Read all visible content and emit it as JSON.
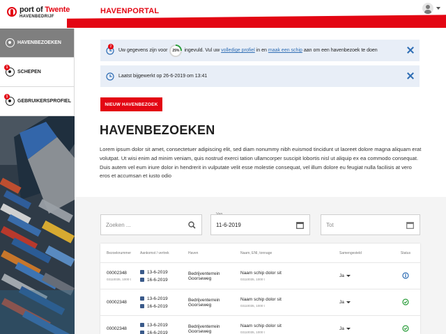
{
  "header": {
    "logo_name_part1": "port of ",
    "logo_name_part2": "Twente",
    "logo_sub": "HAVENBEDRIJF",
    "app_title": "HAVENPORTAL",
    "user_icon": "user-avatar-icon"
  },
  "sidebar": {
    "items": [
      {
        "label": "HAVENBEZOEKEN",
        "icon": "anchor-icon",
        "badge": ""
      },
      {
        "label": "SCHEPEN",
        "icon": "ship-icon",
        "badge": "1"
      },
      {
        "label": "GEBRUIKERSPROFIEL",
        "icon": "user-icon",
        "badge": "1"
      }
    ]
  },
  "alerts": [
    {
      "badge": "2",
      "text_before": "Uw gegevens zijn voor",
      "progress_label": "25%",
      "progress": 0.25,
      "text_mid": "ingevuld. Vul uw",
      "link1": "volledige profiel",
      "text_mid2": "in en",
      "link2": "maak een schip",
      "text_after": "aan om een havenbezoek te doen"
    },
    {
      "text": "Laatst bijgewerkt op 26-6-2019 om 13:41"
    }
  ],
  "main": {
    "new_button": "NIEUW HAVENBEZOEK",
    "title": "HAVENBEZOEKEN",
    "intro": "Lorem ipsum dolor sit amet, consectetuer adipiscing elit, sed diam nonummy nibh euismod tincidunt ut laoreet dolore magna aliquam erat volutpat. Ut wisi enim ad minim veniam, quis nostrud exerci tation ullamcorper suscipit lobortis nisl ut aliquip ex ea commodo consequat. Duis autem vel eum iriure dolor in hendrerit in vulputate velit esse molestie consequat, vel illum dolore eu feugiat nulla facilisis at vero eros et accumsan et iusto odio"
  },
  "filters": {
    "search_placeholder": "Zoeken ...",
    "van_label": "Van",
    "van_value": "11-6-2019",
    "tot_placeholder": "Tot"
  },
  "table": {
    "headers": [
      "Bezoeknummer",
      "Aankomst / vertrek",
      "Haven",
      "Naam, ENI, tonnage",
      "Samengesteld",
      "Status"
    ],
    "rows": [
      {
        "nummer": "00002348",
        "nummer_sub": "03110035, 1000 t",
        "aankomst": "13-6-2019",
        "vertrek": "16-6-2019",
        "haven1": "Bedrijventerrein",
        "haven2": "Goorseweg",
        "naam": "Naam schip dolor sit",
        "naam_sub": "03110035, 1000 t",
        "samengesteld": "Ja",
        "status": "info"
      },
      {
        "nummer": "00002348",
        "nummer_sub": "",
        "aankomst": "13-6-2019",
        "vertrek": "16-6-2019",
        "haven1": "Bedrijventerrein",
        "haven2": "Goorseweg",
        "naam": "Naam schip dolor sit",
        "naam_sub": "03110035, 1000 t",
        "samengesteld": "Ja",
        "status": "ok"
      },
      {
        "nummer": "00002348",
        "nummer_sub": "",
        "aankomst": "13-6-2019",
        "vertrek": "16-6-2019",
        "haven1": "Bedrijventerrein",
        "haven2": "Goorseweg",
        "naam": "Naam schip dolor sit",
        "naam_sub": "03110035, 1000 t",
        "samengesteld": "Ja",
        "status": "ok"
      }
    ]
  },
  "colors": {
    "brand_red": "#e30613",
    "link_blue": "#2e6db4",
    "ok_green": "#2a9d3a"
  }
}
